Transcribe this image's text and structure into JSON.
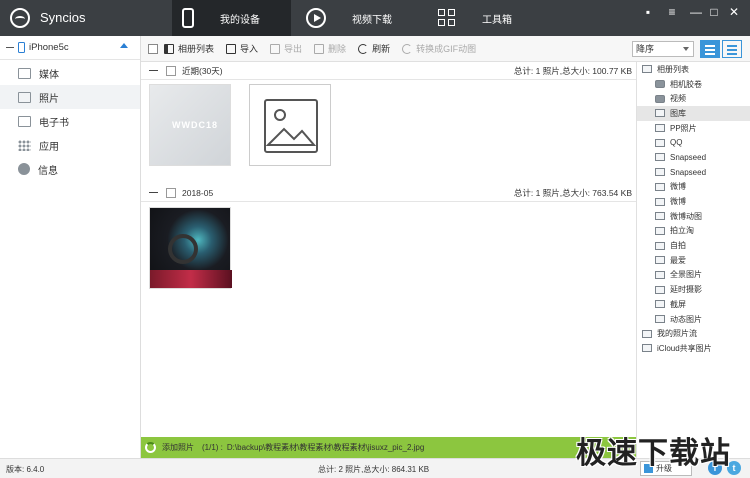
{
  "app": {
    "title": "Syncios"
  },
  "nav": {
    "tabs": [
      {
        "label": "我的设备",
        "icon": "phone-icon"
      },
      {
        "label": "视频下载",
        "icon": "play-icon"
      },
      {
        "label": "工具箱",
        "icon": "toolbox-icon"
      }
    ]
  },
  "window_controls": {
    "chat": "▪",
    "menu": "≡",
    "minimize": "—",
    "maximize": "□",
    "close": "✕"
  },
  "sidebar": {
    "device": "iPhone5c",
    "items": [
      {
        "label": "媒体",
        "icon": "media-icon"
      },
      {
        "label": "照片",
        "icon": "photo-icon"
      },
      {
        "label": "电子书",
        "icon": "ebook-icon"
      },
      {
        "label": "应用",
        "icon": "apps-icon"
      },
      {
        "label": "信息",
        "icon": "info-icon"
      }
    ]
  },
  "toolbar": {
    "album_list": "相册列表",
    "import": "导入",
    "export": "导出",
    "delete": "删除",
    "refresh": "刷新",
    "convert_gif": "转换成GIF动图",
    "sort": "降序"
  },
  "groups": [
    {
      "title": "近期(30天)",
      "summary": "总计: 1 照片,总大小: 100.77 KB",
      "wwdc_text": "WWDC18"
    },
    {
      "title": "2018-05",
      "summary": "总计: 1 照片,总大小: 763.54 KB"
    }
  ],
  "album_panel": {
    "items": [
      {
        "label": "相册列表"
      },
      {
        "label": "相机胶卷"
      },
      {
        "label": "视频"
      },
      {
        "label": "图库"
      },
      {
        "label": "PP照片"
      },
      {
        "label": "QQ"
      },
      {
        "label": "Snapseed"
      },
      {
        "label": "Snapseed"
      },
      {
        "label": "微博"
      },
      {
        "label": "微博"
      },
      {
        "label": "微博动图"
      },
      {
        "label": "拍立淘"
      },
      {
        "label": "自拍"
      },
      {
        "label": "最爱"
      },
      {
        "label": "全景图片"
      },
      {
        "label": "延时摄影"
      },
      {
        "label": "截屏"
      },
      {
        "label": "动态图片"
      },
      {
        "label": "我的照片流"
      },
      {
        "label": "iCloud共享图片"
      }
    ]
  },
  "status": {
    "add_label": "添加照片",
    "add_progress": "(1/1) :",
    "add_path": "D:\\backup\\教程素材\\教程素材\\教程素材\\jisuxz_pic_2.jpg",
    "version": "版本: 6.4.0",
    "total": "总计: 2 照片,总大小: 864.31 KB",
    "upgrade": "升级",
    "facebook": "f",
    "twitter": "t"
  },
  "watermark": "极速下载站"
}
